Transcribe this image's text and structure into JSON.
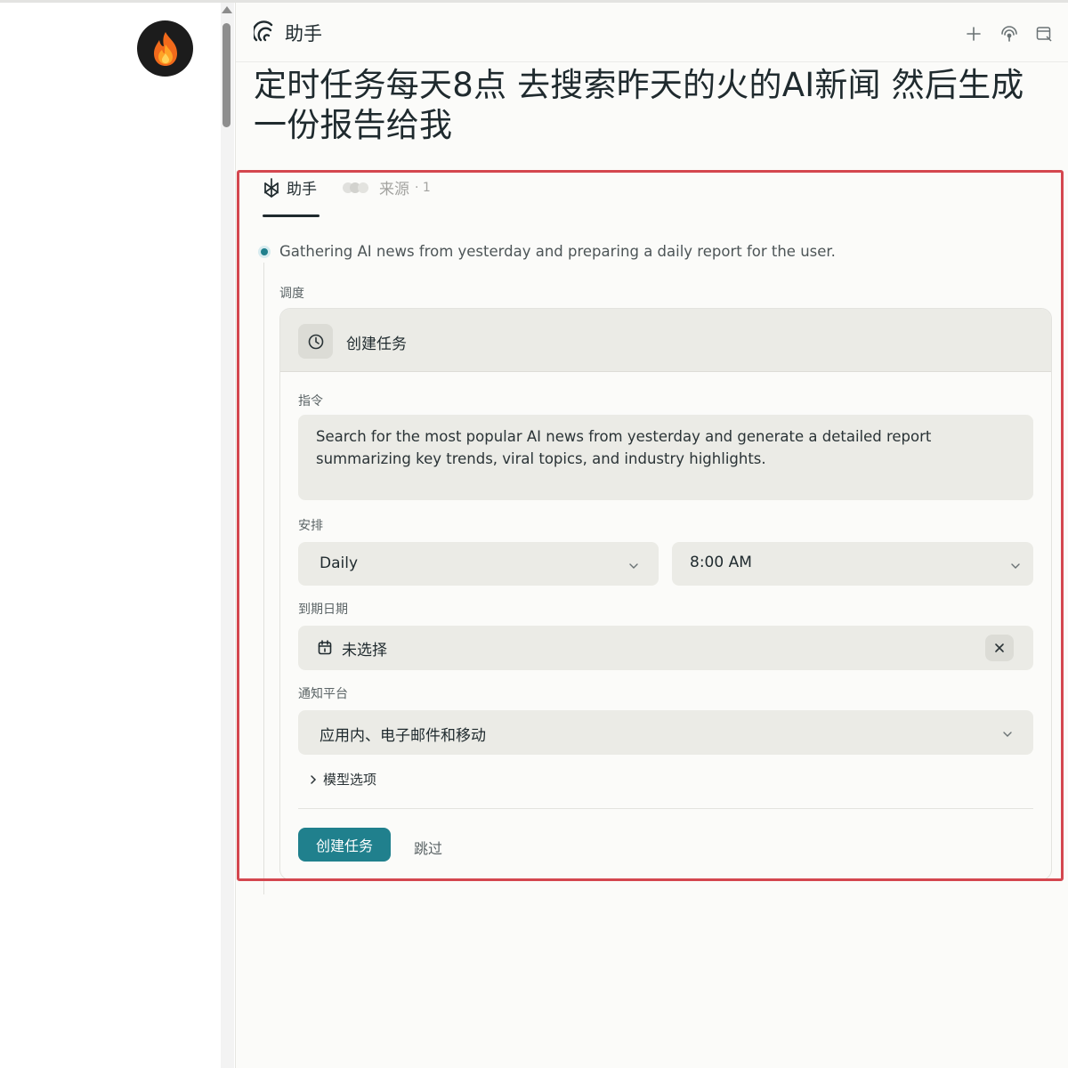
{
  "header": {
    "title": "助手"
  },
  "question": "定时任务每天8点 去搜索昨天的火的AI新闻 然后生成一份报告给我",
  "tabs": {
    "assistant": "助手",
    "sources": "来源",
    "sources_count": "· 1"
  },
  "step": {
    "text": "Gathering AI news from yesterday and preparing a daily report for the user."
  },
  "schedule_section": {
    "label": "调度"
  },
  "task_card": {
    "title": "创建任务",
    "instruction_label": "指令",
    "instruction": "Search for the most popular AI news from yesterday and generate a detailed report summarizing key trends, viral topics, and industry highlights.",
    "schedule_label": "安排",
    "frequency": "Daily",
    "time": "8:00 AM",
    "due_date_label": "到期日期",
    "due_date_value": "未选择",
    "notify_label": "通知平台",
    "notify_value": "应用内、电子邮件和移动",
    "model_options": "模型选项",
    "create_button": "创建任务",
    "skip_button": "跳过"
  },
  "colors": {
    "accent": "#20808d",
    "highlight_border": "#d4474f",
    "field_bg": "#ebebe6"
  },
  "icons": [
    "fire-avatar-icon",
    "perplexity-logo-icon",
    "plus-icon",
    "broadcast-icon",
    "window-icon",
    "assistant-icon",
    "source-dots-icon",
    "clock-icon",
    "chevron-down-icon",
    "calendar-icon",
    "close-icon",
    "chevron-right-icon"
  ]
}
